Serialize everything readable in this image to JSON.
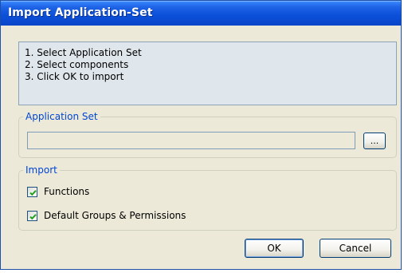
{
  "window": {
    "title": "Import Application-Set"
  },
  "instructions": {
    "lines": [
      "1. Select Application Set",
      "2. Select components",
      "3. Click OK to import"
    ]
  },
  "application_set": {
    "legend": "Application Set",
    "path_value": "",
    "browse_label": "..."
  },
  "import": {
    "legend": "Import",
    "options": [
      {
        "label": "Functions",
        "checked": true
      },
      {
        "label": "Default Groups & Permissions",
        "checked": true
      }
    ]
  },
  "buttons": {
    "ok_label": "OK",
    "cancel_label": "Cancel"
  },
  "colors": {
    "titlebar": "#0a46c8",
    "dialog_bg": "#ece9d8",
    "legend_text": "#0046d5",
    "checkmark": "#21a121"
  }
}
